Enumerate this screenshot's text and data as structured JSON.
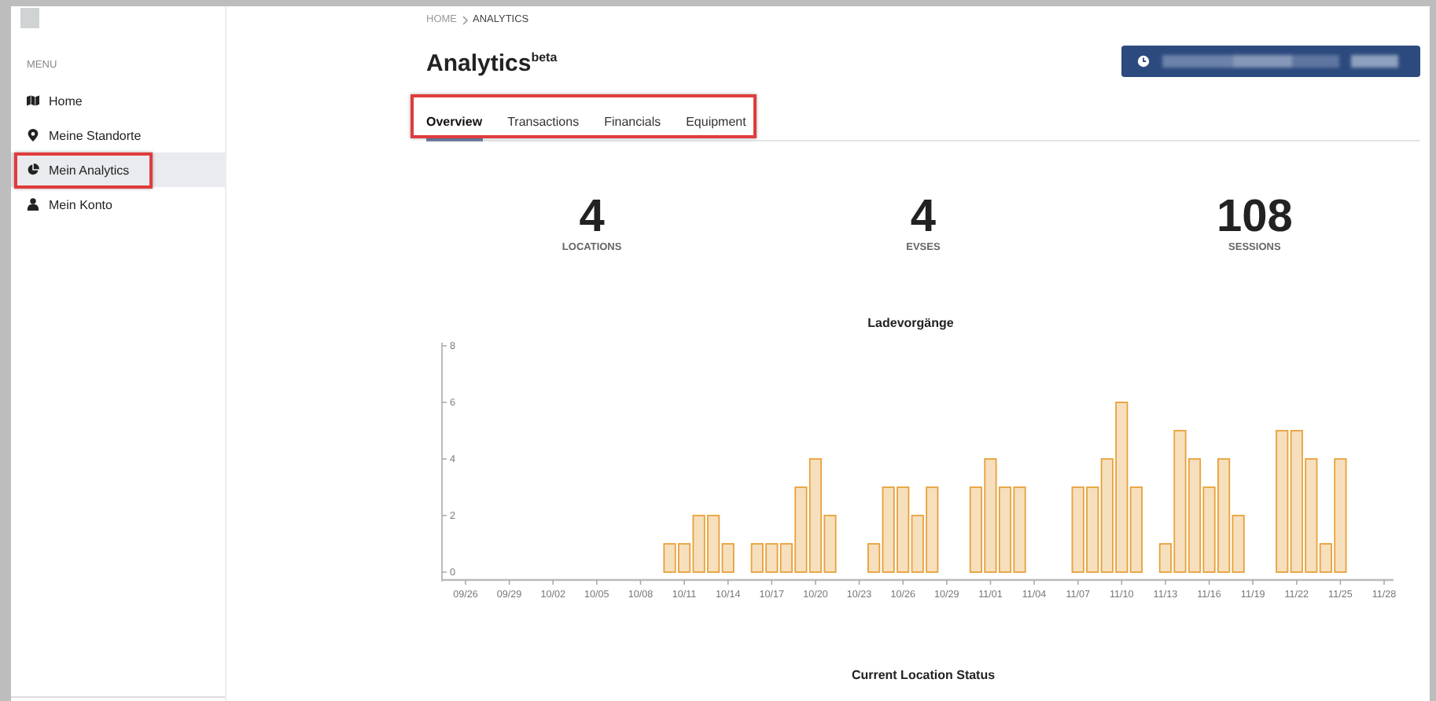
{
  "sidebar": {
    "heading": "MENU",
    "items": [
      {
        "label": "Home",
        "selected": false,
        "highlighted": false
      },
      {
        "label": "Meine Standorte",
        "selected": false,
        "highlighted": false
      },
      {
        "label": "Mein Analytics",
        "selected": true,
        "highlighted": true
      },
      {
        "label": "Mein Konto",
        "selected": false,
        "highlighted": false
      }
    ]
  },
  "breadcrumb": [
    "HOME",
    "ANALYTICS"
  ],
  "title": "Analytics$^{beta}$",
  "tabs_highlighted": true,
  "tabs": [
    {
      "label": "Overview",
      "selected": true
    },
    {
      "label": "Transactions",
      "selected": false
    },
    {
      "label": "Financials",
      "selected": false
    },
    {
      "label": "Equipment",
      "selected": false
    }
  ],
  "stats": [
    {
      "value": "4",
      "label": "LOCATIONS"
    },
    {
      "value": "4",
      "label": "EVSES"
    },
    {
      "value": "108",
      "label": "SESSIONS"
    }
  ],
  "chart_data": {
    "type": "bar",
    "title": "Ladevorgänge",
    "categories": [
      "09/26",
      null,
      null,
      "09/29",
      null,
      null,
      "10/02",
      null,
      null,
      "10/05",
      null,
      null,
      "10/08",
      null,
      null,
      "10/11",
      null,
      null,
      "10/14",
      null,
      null,
      "10/17",
      null,
      null,
      "10/20",
      null,
      null,
      "10/23",
      null,
      null,
      "10/26",
      null,
      null,
      "10/29",
      null,
      null,
      "11/01",
      null,
      null,
      "11/04",
      null,
      null,
      "11/07",
      null,
      null,
      "11/10",
      null,
      null,
      "11/13",
      null,
      null,
      "11/16",
      null,
      null,
      "11/19",
      null,
      null,
      "11/22",
      null,
      null,
      "11/25",
      null,
      null,
      "11/28"
    ],
    "values": [
      0,
      0,
      0,
      0,
      0,
      0,
      0,
      0,
      0,
      0,
      0,
      0,
      0,
      0,
      1,
      1,
      2,
      2,
      1,
      0,
      1,
      1,
      1,
      3,
      4,
      2,
      0,
      0,
      1,
      3,
      3,
      2,
      3,
      0,
      0,
      3,
      4,
      3,
      3,
      0,
      0,
      0,
      3,
      3,
      4,
      6,
      3,
      0,
      1,
      5,
      4,
      3,
      4,
      2,
      0,
      0,
      5,
      5,
      4,
      1,
      4,
      0,
      0,
      0
    ],
    "yticks": [
      0,
      2,
      4,
      6,
      8
    ],
    "ylim": [
      0,
      8
    ]
  },
  "section_title": "Current Location Status"
}
